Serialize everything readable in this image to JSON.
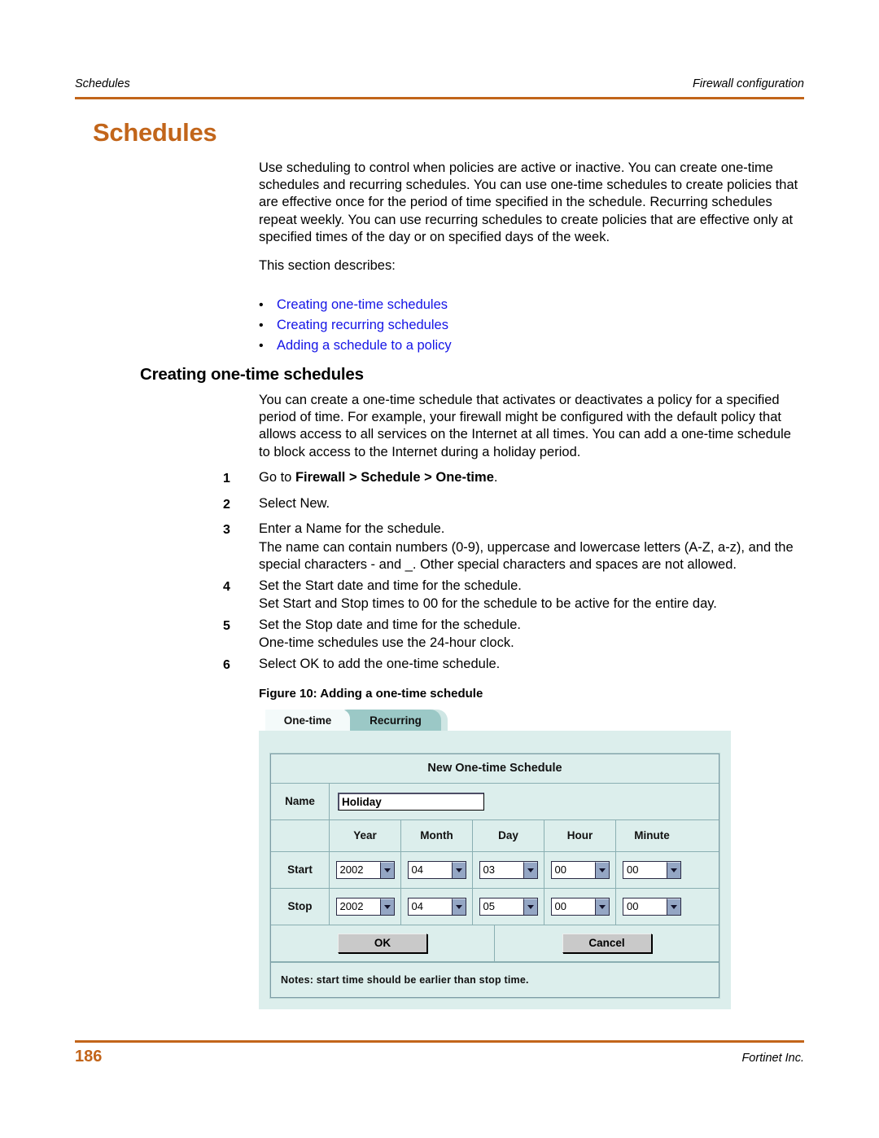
{
  "running_head": {
    "left": "Schedules",
    "right": "Firewall configuration"
  },
  "chapter_title": "Schedules",
  "intro": {
    "paragraph": "Use scheduling to control when policies are active or inactive. You can create one-time schedules and recurring schedules. You can use one-time schedules to create policies that are effective once for the period of time specified in the schedule. Recurring schedules repeat weekly. You can use recurring schedules to create policies that are effective only at specified times of the day or on specified days of the week.",
    "lead_in": "This section describes:",
    "links": [
      "Creating one-time schedules",
      "Creating recurring schedules",
      "Adding a schedule to a policy"
    ],
    "bullet_glyph": "•"
  },
  "section": {
    "heading": "Creating one-time schedules",
    "intro": "You can create a one-time schedule that activates or deactivates a policy for a specified period of time. For example, your firewall might be configured with the default policy that allows access to all services on the Internet at all times. You can add a one-time schedule to block access to the Internet during a holiday period.",
    "steps": [
      {
        "num": "1",
        "text_before": "Go to ",
        "text_bold": "Firewall > Schedule > One-time",
        "text_after": ".",
        "sub": []
      },
      {
        "num": "2",
        "text_before": "Select New.",
        "text_bold": "",
        "text_after": "",
        "sub": []
      },
      {
        "num": "3",
        "text_before": "Enter a Name for the schedule.",
        "text_bold": "",
        "text_after": "",
        "sub": [
          "The name can contain numbers (0-9), uppercase and lowercase letters (A-Z, a-z), and the special characters - and _. Other special characters and spaces are not allowed."
        ]
      },
      {
        "num": "4",
        "text_before": "Set the Start date and time for the schedule.",
        "text_bold": "",
        "text_after": "",
        "sub": [
          "Set Start and Stop times to 00 for the schedule to be active for the entire day."
        ]
      },
      {
        "num": "5",
        "text_before": "Set the Stop date and time for the schedule.",
        "text_bold": "",
        "text_after": "",
        "sub": [
          "One-time schedules use the 24-hour clock."
        ]
      },
      {
        "num": "6",
        "text_before": "Select OK to add the one-time schedule.",
        "text_bold": "",
        "text_after": "",
        "sub": []
      }
    ]
  },
  "figure": {
    "caption": "Figure 10: Adding a one-time schedule",
    "tabs": [
      {
        "label": "One-time",
        "active": true
      },
      {
        "label": "Recurring",
        "active": false
      }
    ],
    "form_title": "New One-time Schedule",
    "name_label": "Name",
    "name_value": "Holiday",
    "column_headers": [
      "Year",
      "Month",
      "Day",
      "Hour",
      "Minute"
    ],
    "rows": [
      {
        "label": "Start",
        "year": "2002",
        "month": "04",
        "day": "03",
        "hour": "00",
        "minute": "00"
      },
      {
        "label": "Stop",
        "year": "2002",
        "month": "04",
        "day": "05",
        "hour": "00",
        "minute": "00"
      }
    ],
    "ok_label": "OK",
    "cancel_label": "Cancel",
    "notes": "Notes: start time should be earlier than stop time."
  },
  "footer": {
    "page_number": "186",
    "company": "Fortinet Inc."
  },
  "colors": {
    "accent_orange": "#C2651A",
    "link_blue": "#1414E6",
    "panel_mint": "#DCEEEC",
    "tab_teal": "#9BC8C6"
  }
}
